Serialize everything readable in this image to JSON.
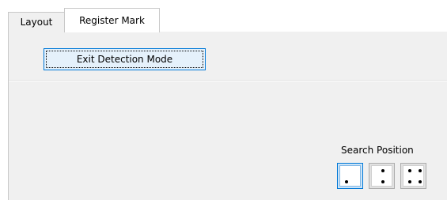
{
  "tabs": [
    {
      "label": "Layout",
      "active": false
    },
    {
      "label": "Register Mark",
      "active": true
    }
  ],
  "buttons": {
    "exit_detection": "Exit Detection Mode"
  },
  "search_position": {
    "label": "Search Position",
    "options": [
      {
        "icon": "one-dot-position-icon",
        "selected": true
      },
      {
        "icon": "two-dot-vertical-position-icon",
        "selected": false
      },
      {
        "icon": "four-dot-position-icon",
        "selected": false
      }
    ]
  },
  "colors": {
    "accent": "#0078d7",
    "panel": "#f0f0f0",
    "border": "#c8c8c8"
  }
}
